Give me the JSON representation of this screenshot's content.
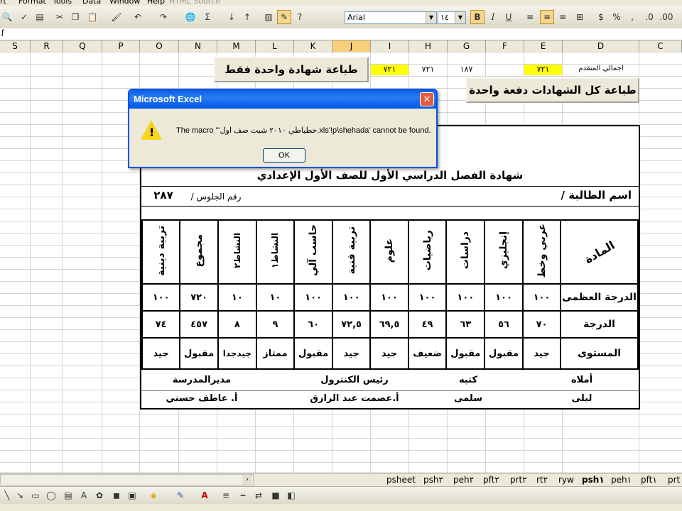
{
  "menu": [
    "rt",
    "Format",
    "Tools",
    "Data",
    "Window",
    "Help",
    "HTML Source"
  ],
  "toolbar": {
    "font_name": "Arial",
    "font_size": "١٤",
    "bold": "B",
    "italic": "I",
    "underline": "U",
    "percent": "%",
    "comma": ","
  },
  "columns": [
    "S",
    "R",
    "Q",
    "P",
    "O",
    "N",
    "M",
    "L",
    "K",
    "J",
    "I",
    "H",
    "G",
    "F",
    "E",
    "D",
    "C"
  ],
  "top_row": {
    "label": "اجمالي المتقدم",
    "values": [
      "٧٢١",
      "٧٢١",
      "١٨٧",
      "٧٢١"
    ]
  },
  "buttons": {
    "print_one": "طباعة شهادة واحدة فقط",
    "print_all": "طباعة كل الشهادات دفعة واحدة"
  },
  "certificate": {
    "title": "شهادة الفصل الدراسي الأول للصف الأول الإعدادي",
    "student_label": "اسم الطالبة /",
    "seat_label": "رقم الجلوس /",
    "seat_number": "٢٨٧",
    "subject_header": "المادة",
    "subjects": [
      "عربي وخط",
      "إنجليزي",
      "دراسات",
      "رياضيات",
      "علوم",
      "تربية فنية",
      "حاسب آلي",
      "النشاط١",
      "النشاط٢",
      "مجموع",
      "تربية دينية"
    ],
    "rows": [
      {
        "label": "الدرجة العظمى",
        "values": [
          "١٠٠",
          "١٠٠",
          "١٠٠",
          "١٠٠",
          "١٠٠",
          "١٠٠",
          "١٠٠",
          "١٠",
          "١٠",
          "٧٢٠",
          "١٠٠"
        ]
      },
      {
        "label": "الدرجة",
        "values": [
          "٧٠",
          "٥٦",
          "٦٣",
          "٤٩",
          "٦٩,٥",
          "٧٢,٥",
          "٦٠",
          "٩",
          "٨",
          "٤٥٧",
          "٧٤"
        ]
      },
      {
        "label": "المستوى",
        "values": [
          "جيد",
          "مقبول",
          "مقبول",
          "ضعيف",
          "جيد",
          "جيد",
          "مقبول",
          "ممتاز",
          "جيدجدا",
          "مقبول",
          "جيد"
        ]
      }
    ],
    "signatures": {
      "dictated_label": "أملاه",
      "dictated_name": "ليلى",
      "writer_label": "كتبه",
      "writer_name": "سلمى",
      "control_label": "رئيس الكنترول",
      "control_name": "أ.عصمت عبد الرازق",
      "principal_label": "مديرالمدرسة",
      "principal_name": "أ. عاطف حسني"
    }
  },
  "dialog": {
    "title": "Microsoft Excel",
    "message": "The macro '\"حطياطي ٢٠١٠ شيت صف اول.xls'!p\\shehada' cannot be found.",
    "ok": "OK"
  },
  "sheet_tabs": [
    "psheet",
    "psh٢",
    "peh٢",
    "pft٢",
    "prt٢",
    "rt٢",
    "ryw",
    "psh١",
    "peh١",
    "pft١",
    "prt"
  ],
  "active_tab": "psh١"
}
